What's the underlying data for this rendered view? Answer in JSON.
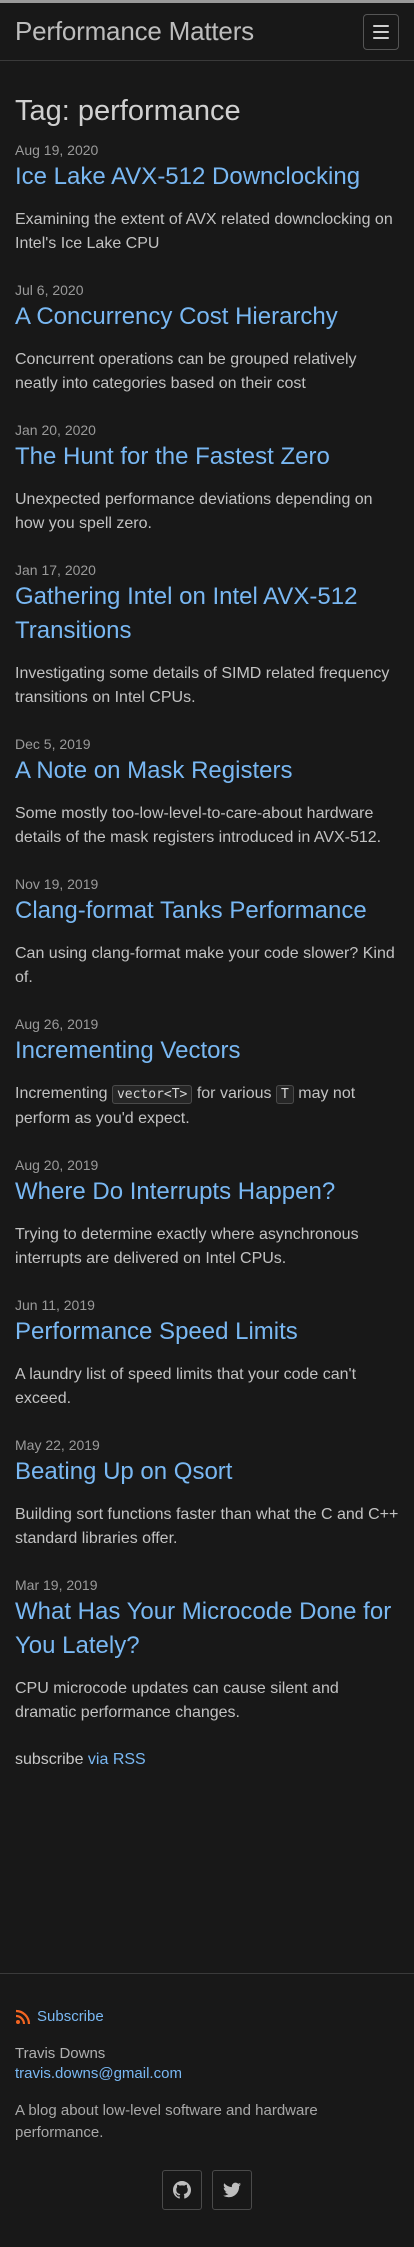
{
  "header": {
    "site_title": "Performance Matters"
  },
  "page": {
    "heading": "Tag: performance"
  },
  "posts": [
    {
      "date": "Aug 19, 2020",
      "title": "Ice Lake AVX-512 Downclocking",
      "excerpt": "Examining the extent of AVX related downclocking on Intel's Ice Lake CPU"
    },
    {
      "date": "Jul 6, 2020",
      "title": "A Concurrency Cost Hierarchy",
      "excerpt": "Concurrent operations can be grouped relatively neatly into categories based on their cost"
    },
    {
      "date": "Jan 20, 2020",
      "title": "The Hunt for the Fastest Zero",
      "excerpt": "Unexpected performance deviations depending on how you spell zero."
    },
    {
      "date": "Jan 17, 2020",
      "title": "Gathering Intel on Intel AVX-512 Transitions",
      "excerpt": "Investigating some details of SIMD related frequency transitions on Intel CPUs."
    },
    {
      "date": "Dec 5, 2019",
      "title": "A Note on Mask Registers",
      "excerpt": "Some mostly too-low-level-to-care-about hardware details of the mask registers introduced in AVX-512."
    },
    {
      "date": "Nov 19, 2019",
      "title": "Clang-format Tanks Performance",
      "excerpt": "Can using clang-format make your code slower? Kind of."
    },
    {
      "date": "Aug 26, 2019",
      "title": "Incrementing Vectors",
      "excerpt_parts": {
        "pre": "Incrementing ",
        "code1": "vector<T>",
        "mid": " for various ",
        "code2": "T",
        "post": " may not perform as you'd expect."
      }
    },
    {
      "date": "Aug 20, 2019",
      "title": "Where Do Interrupts Happen?",
      "excerpt": "Trying to determine exactly where asynchronous interrupts are delivered on Intel CPUs."
    },
    {
      "date": "Jun 11, 2019",
      "title": "Performance Speed Limits",
      "excerpt": "A laundry list of speed limits that your code can't exceed."
    },
    {
      "date": "May 22, 2019",
      "title": "Beating Up on Qsort",
      "excerpt": "Building sort functions faster than what the C and C++ standard libraries offer."
    },
    {
      "date": "Mar 19, 2019",
      "title": "What Has Your Microcode Done for You Lately?",
      "excerpt": "CPU microcode updates can cause silent and dramatic performance changes."
    }
  ],
  "rss": {
    "prefix": "subscribe ",
    "link_text": "via RSS"
  },
  "footer": {
    "subscribe_label": "Subscribe",
    "author": "Travis Downs",
    "email": "travis.downs@gmail.com",
    "about": "A blog about low-level software and hardware performance.",
    "social_icons": [
      "github-icon",
      "twitter-icon"
    ]
  },
  "colors": {
    "background": "#181818",
    "link": "#79b8f3",
    "rss": "#f26522"
  }
}
